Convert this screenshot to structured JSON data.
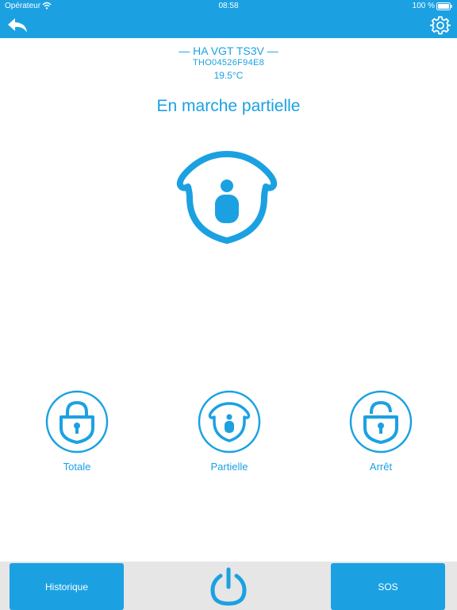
{
  "status_bar": {
    "carrier": "Opérateur",
    "time": "08:58",
    "battery_pct": "100 %"
  },
  "header": {
    "back_icon": "back-arrow-icon",
    "settings_icon": "gear-icon"
  },
  "device": {
    "name": "— HA VGT TS3V —",
    "id": "THO04526F94E8",
    "temperature": "19.5°C"
  },
  "current_mode": {
    "label": "En marche partielle",
    "icon": "house-person-icon"
  },
  "modes": [
    {
      "label": "Totale",
      "icon": "lock-closed-icon"
    },
    {
      "label": "Partielle",
      "icon": "house-person-icon"
    },
    {
      "label": "Arrêt",
      "icon": "lock-open-icon"
    }
  ],
  "footer": {
    "history_label": "Historique",
    "power_icon": "power-icon",
    "sos_label": "SOS"
  },
  "colors": {
    "accent": "#1ba1e2",
    "footer_bg": "#e6e6e6",
    "background": "#ffffff"
  }
}
